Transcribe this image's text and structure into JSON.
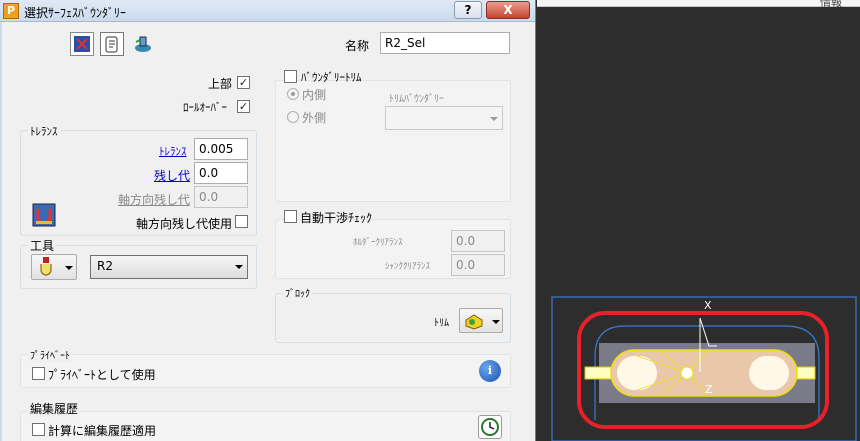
{
  "window": {
    "title": "選択ｻｰﾌｪｽﾊﾞｳﾝﾀﾞﾘｰ",
    "app_icon": "P",
    "help_label": "?",
    "close_label": "X"
  },
  "header": {
    "name_label": "名称",
    "name_value": "R2_Sel"
  },
  "options": {
    "top_label": "上部",
    "top_checked": true,
    "rolloff_label": "ﾛｰﾙｵｰﾊﾞｰ",
    "rolloff_checked": true
  },
  "tolerance_group": {
    "title": "ﾄﾚﾗﾝｽ",
    "tolerance_label": "ﾄﾚﾗﾝｽ",
    "tolerance_value": "0.005",
    "stock_label": "残し代",
    "stock_value": "0.0",
    "axial_stock_label": "軸方向残し代",
    "axial_stock_value": "0.0",
    "use_axial_label": "軸方向残し代使用",
    "use_axial_checked": false
  },
  "tool_group": {
    "title": "工具",
    "tool_value": "R2"
  },
  "boundary_trim": {
    "title": "ﾊﾞｳﾝﾀﾞﾘｰﾄﾘﾑ",
    "checked": false,
    "inside_label": "内側",
    "outside_label": "外側",
    "trim_boundary_label": "ﾄﾘﾑﾊﾞｳﾝﾀﾞﾘｰ"
  },
  "collision": {
    "title": "自動干渉ﾁｪｯｸ",
    "checked": false,
    "holder_label": "ﾎﾙﾀﾞｰｸﾘｱﾗﾝｽ",
    "holder_value": "0.0",
    "shank_label": "ｼｬﾝｸｸﾘｱﾗﾝｽ",
    "shank_value": "0.0"
  },
  "block_group": {
    "title": "ﾌﾞﾛｯｸ",
    "trim_label": "ﾄﾘﾑ"
  },
  "private_group": {
    "title": "ﾌﾟﾗｲﾍﾞｰﾄ",
    "use_label": "ﾌﾟﾗｲﾍﾞｰﾄとして使用",
    "checked": false,
    "info_label": "i"
  },
  "history_group": {
    "title": "編集履歴",
    "apply_label": "計算に編集履歴適用",
    "checked": false
  },
  "viewport": {
    "x_axis": "X",
    "z_axis": "Z",
    "header_text": "情報"
  },
  "colors": {
    "highlight_ring": "#e8202a",
    "boundary_blue": "#3a7bd5",
    "part_yellow": "#f0e000"
  }
}
